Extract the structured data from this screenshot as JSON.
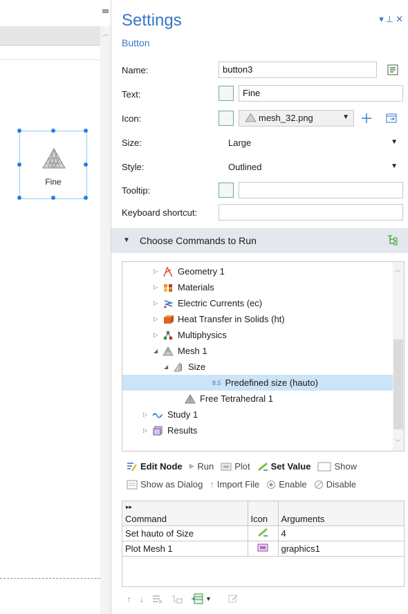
{
  "canvas": {
    "widget_label": "Fine"
  },
  "settings": {
    "title": "Settings",
    "subtitle": "Button",
    "form": {
      "name_label": "Name:",
      "name_value": "button3",
      "text_label": "Text:",
      "text_value": "Fine",
      "icon_label": "Icon:",
      "icon_value": "mesh_32.png",
      "size_label": "Size:",
      "size_value": "Large",
      "style_label": "Style:",
      "style_value": "Outlined",
      "tooltip_label": "Tooltip:",
      "tooltip_value": "",
      "shortcut_label": "Keyboard shortcut:",
      "shortcut_value": ""
    },
    "section_title": "Choose Commands to Run",
    "tree": [
      {
        "label": "Geometry 1",
        "icon": "geometry-icon"
      },
      {
        "label": "Materials",
        "icon": "materials-icon"
      },
      {
        "label": "Electric Currents (ec)",
        "icon": "electric-currents-icon"
      },
      {
        "label": "Heat Transfer in Solids (ht)",
        "icon": "heat-transfer-icon"
      },
      {
        "label": "Multiphysics",
        "icon": "multiphysics-icon"
      },
      {
        "label": "Mesh 1",
        "icon": "mesh-icon"
      },
      {
        "label": "Size",
        "icon": "size-icon"
      },
      {
        "label": "Predefined size (hauto)",
        "icon": "predefined-size-icon",
        "badge": "8.5"
      },
      {
        "label": "Free Tetrahedral 1",
        "icon": "free-tetrahedral-icon"
      },
      {
        "label": "Study 1",
        "icon": "study-icon"
      },
      {
        "label": "Results",
        "icon": "results-icon"
      }
    ],
    "actions_row1": {
      "edit_node": "Edit Node",
      "run": "Run",
      "plot": "Plot",
      "set_value": "Set Value",
      "show": "Show"
    },
    "actions_row2": {
      "show_as_dialog": "Show as Dialog",
      "import_file": "Import File",
      "enable": "Enable",
      "disable": "Disable"
    },
    "table": {
      "headers": [
        "Command",
        "Icon",
        "Arguments"
      ],
      "rows": [
        {
          "command": "Set hauto of Size",
          "icon": "set-value-icon",
          "arguments": "4"
        },
        {
          "command": "Plot Mesh 1",
          "icon": "plot-icon",
          "arguments": "graphics1"
        }
      ]
    }
  }
}
